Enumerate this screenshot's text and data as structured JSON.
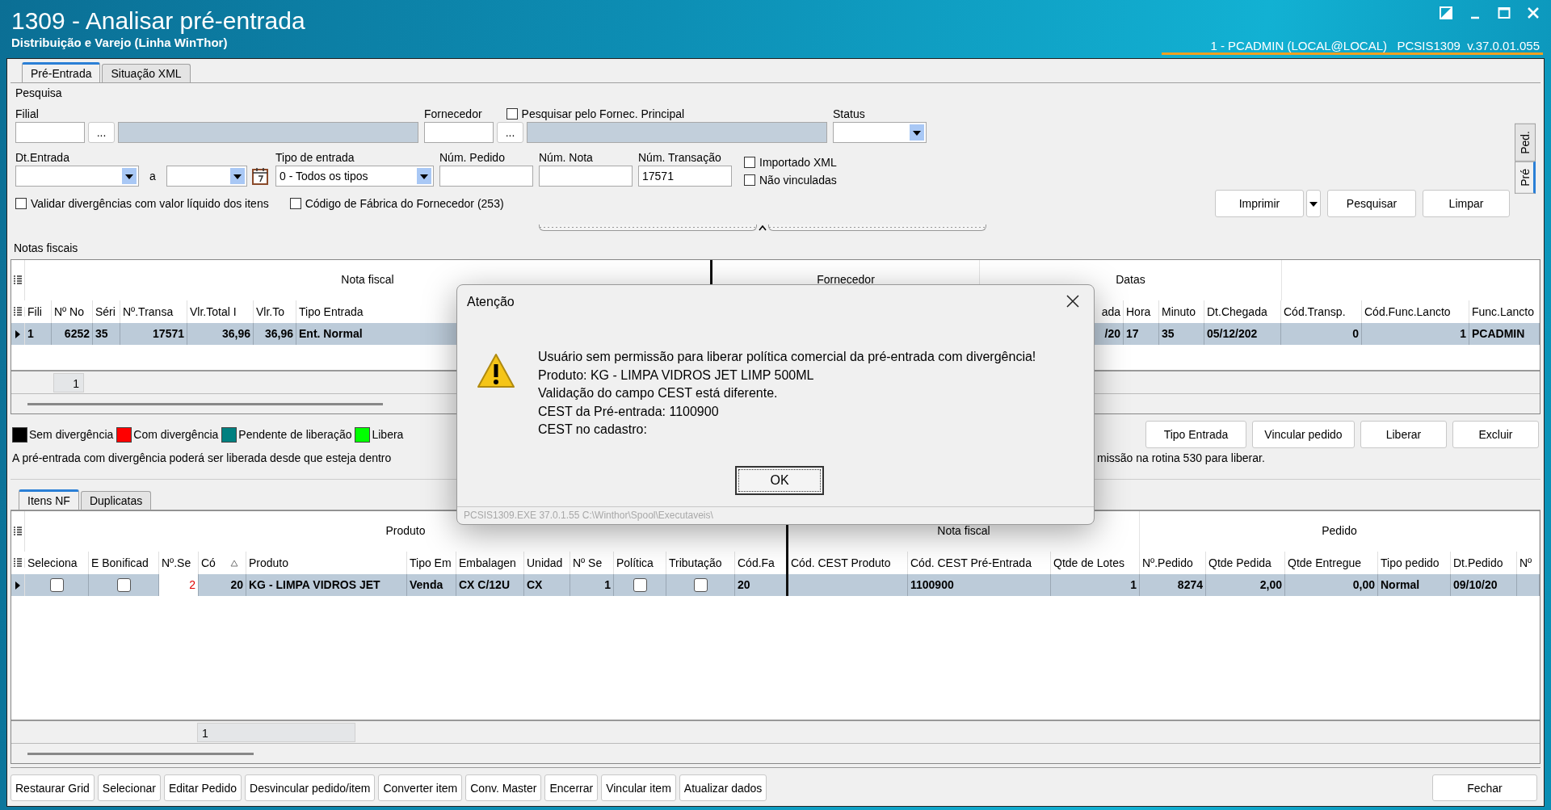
{
  "window": {
    "title": "1309 - Analisar pré-entrada",
    "subtitle": "Distribuição e Varejo (Linha WinThor)",
    "session": "1 - PCADMIN (LOCAL@LOCAL)   PCSIS1309  v.37.0.01.055"
  },
  "main_tabs": [
    {
      "label": "Pré-Entrada",
      "selected": true
    },
    {
      "label": "Situação XML",
      "selected": false
    }
  ],
  "side_tabs": [
    {
      "label": "Ped.",
      "selected": false
    },
    {
      "label": "Pré",
      "selected": true
    }
  ],
  "search": {
    "title": "Pesquisa",
    "filial": {
      "label": "Filial",
      "lookup_button": "..."
    },
    "fornecedor": {
      "label": "Fornecedor",
      "lookup_button": "..."
    },
    "principal_checkbox": {
      "label": "Pesquisar pelo Fornec. Principal",
      "checked": false
    },
    "status": {
      "label": "Status"
    },
    "dt_entrada": {
      "label": "Dt.Entrada",
      "separator": "a"
    },
    "tipo_entrada": {
      "label": "Tipo de entrada",
      "value": "0 - Todos os tipos"
    },
    "num_pedido": {
      "label": "Núm. Pedido"
    },
    "num_nota": {
      "label": "Núm. Nota"
    },
    "num_transacao": {
      "label": "Núm. Transação",
      "value": "17571"
    },
    "options": [
      {
        "label": "Importado XML",
        "checked": false
      },
      {
        "label": "Não vinculadas",
        "checked": false
      }
    ],
    "bottom_options": [
      {
        "label": "Validar divergências com valor líquido dos itens",
        "checked": false
      },
      {
        "label": "Código de Fábrica do Fornecedor (253)",
        "checked": false
      }
    ],
    "buttons": [
      "Imprimir",
      "Pesquisar",
      "Limpar"
    ]
  },
  "notas": {
    "title": "Notas fiscais",
    "groups": [
      "Nota fiscal",
      "Fornecedor",
      "Datas"
    ],
    "columns": [
      "Fili",
      "Nº No",
      "Séri",
      "Nº.Transa",
      "Vlr.Total I",
      "Vlr.To",
      "Tipo Entrada",
      "ada",
      "Hora",
      "Minuto",
      "Dt.Chegada",
      "Cód.Transp.",
      "Cód.Func.Lancto",
      "Func.Lancto"
    ],
    "rows": [
      {
        "selected": true,
        "cells": [
          "1",
          "6252",
          "35",
          "17571",
          "36,96",
          "36,96",
          "Ent. Normal",
          "/20",
          "17",
          "35",
          "05/12/202",
          "0",
          "1",
          "PCADMIN"
        ]
      }
    ],
    "footer": "1",
    "legend": [
      {
        "label": "Sem divergência",
        "color": "#000000"
      },
      {
        "label": "Com divergência",
        "color": "#ff0000"
      },
      {
        "label": "Pendente de liberação",
        "color": "#008080"
      },
      {
        "label": "Libera",
        "color": "#00ff00"
      }
    ],
    "message_parts": [
      "A pré-entrada com divergência poderá ser liberada desde que esteja dentro",
      "missão na rotina 530 para liberar."
    ],
    "buttons": [
      "Tipo Entrada",
      "Vincular pedido",
      "Liberar",
      "Excluir"
    ]
  },
  "items": {
    "tabs": [
      {
        "label": "Itens NF",
        "selected": true
      },
      {
        "label": "Duplicatas",
        "selected": false
      }
    ],
    "groups": [
      "Produto",
      "Nota fiscal",
      "Pedido"
    ],
    "columns": [
      "Seleciona",
      "E Bonificad",
      "Nº.Se",
      "Có",
      "Produto",
      "Tipo Em",
      "Embalagen",
      "Unidad",
      "Nº Se",
      "Política",
      "Tributação",
      "Cód.Fa",
      "Cód. CEST Produto",
      "Cód. CEST Pré-Entrada",
      "Qtde de Lotes",
      "Nº.Pedido",
      "Qtde Pedida",
      "Qtde Entregue",
      "Tipo pedido",
      "Dt.Pedido",
      "Nº"
    ],
    "rows": [
      {
        "selected": true,
        "cells": [
          {
            "kind": "checkbox",
            "checked": false
          },
          {
            "kind": "checkbox",
            "checked": false
          },
          {
            "kind": "alert",
            "text": "2"
          },
          {
            "kind": "text",
            "text": "20"
          },
          {
            "kind": "text",
            "text": "KG - LIMPA VIDROS JET"
          },
          {
            "kind": "text",
            "text": "Venda"
          },
          {
            "kind": "text",
            "text": "CX C/12U"
          },
          {
            "kind": "text",
            "text": "CX"
          },
          {
            "kind": "text",
            "text": "1"
          },
          {
            "kind": "checkbox",
            "checked": false
          },
          {
            "kind": "checkbox",
            "checked": false
          },
          {
            "kind": "text",
            "text": "20"
          },
          {
            "kind": "blank"
          },
          {
            "kind": "text",
            "text": "1100900"
          },
          {
            "kind": "text",
            "text": "1"
          },
          {
            "kind": "text",
            "text": "8274"
          },
          {
            "kind": "text",
            "text": "2,00"
          },
          {
            "kind": "text",
            "text": "0,00"
          },
          {
            "kind": "text",
            "text": "Normal"
          },
          {
            "kind": "text",
            "text": "09/10/20"
          },
          {
            "kind": "blank"
          }
        ]
      }
    ],
    "footer": "1"
  },
  "bottom_buttons": [
    "Restaurar Grid",
    "Selecionar",
    "Editar Pedido",
    "Desvincular pedido/item",
    "Converter item",
    "Conv. Master",
    "Encerrar",
    "Vincular item",
    "Atualizar dados"
  ],
  "close_button": "Fechar",
  "dialog": {
    "title": "Atenção",
    "lines": [
      "Usuário sem permissão para liberar política comercial da pré-entrada com divergência!",
      "Produto: KG - LIMPA VIDROS JET LIMP 500ML",
      "Validação do campo CEST está diferente.",
      "CEST da Pré-entrada: 1100900",
      "CEST no cadastro:"
    ],
    "ok": "OK",
    "footer": "PCSIS1309.EXE 37.0.1.55 C:\\Winthor\\Spool\\Executaveis\\"
  }
}
